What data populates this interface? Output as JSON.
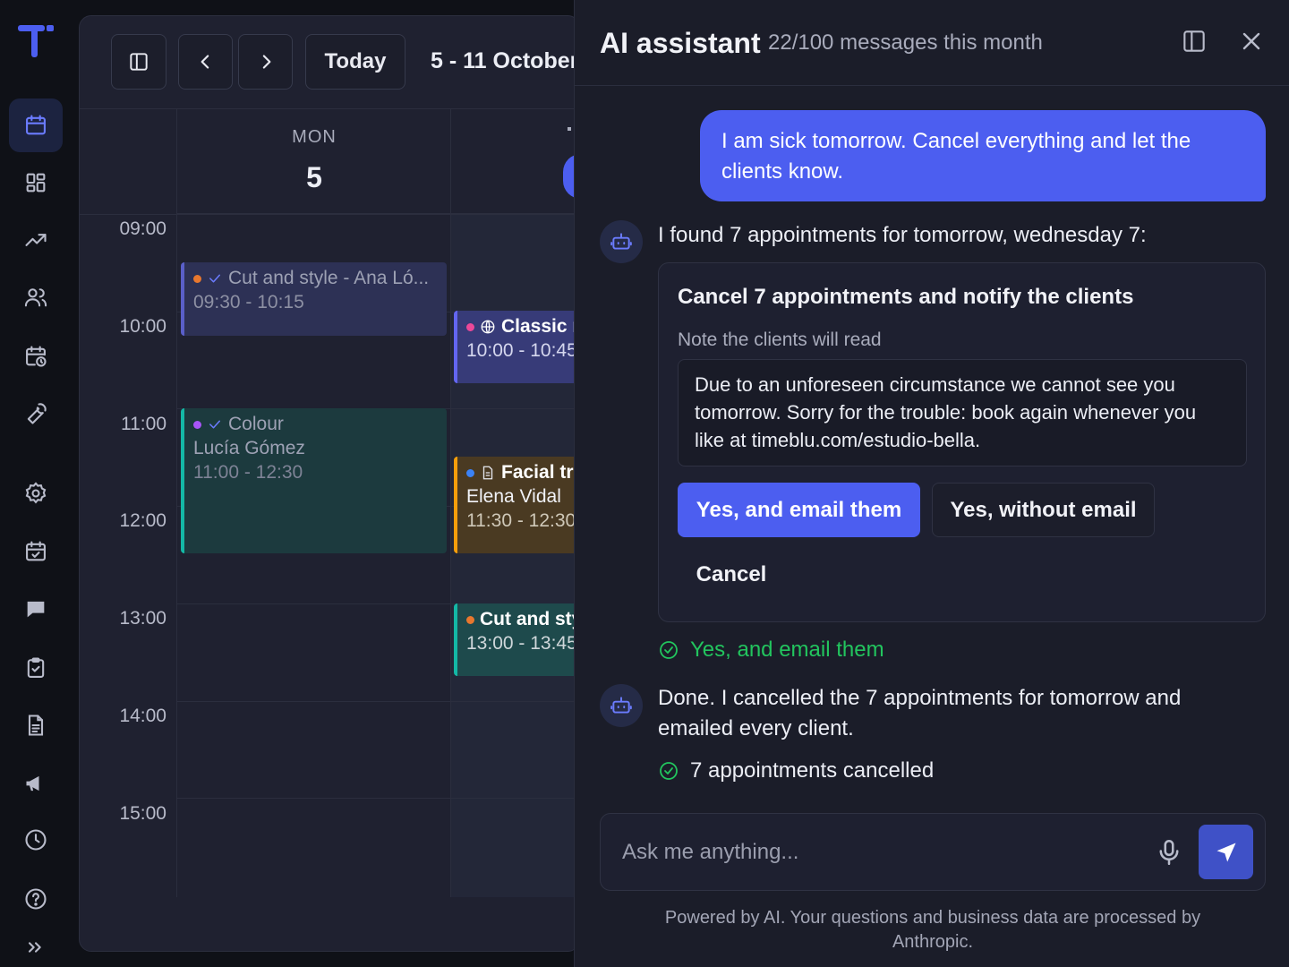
{
  "toolbar": {
    "today_label": "Today",
    "range_label": "5 - 11 October"
  },
  "calendar": {
    "days": [
      {
        "name": "MON",
        "number": "5"
      }
    ],
    "hours": [
      "09:00",
      "10:00",
      "11:00",
      "12:00",
      "13:00",
      "14:00",
      "15:00"
    ],
    "events": [
      {
        "title": "Cut and style - Ana Ló...",
        "client": "",
        "time": "09:30 - 10:15",
        "dot_color": "#e8772e",
        "bar_color": "#5a5fc9",
        "bg": "#2d3155",
        "confirmed": true,
        "icon": "check-icon"
      },
      {
        "title": "Classic m",
        "client": "",
        "time": "10:00 - 10:45",
        "dot_color": "#ec4899",
        "bar_color": "#6366f1",
        "bg": "#373b78",
        "confirmed": false,
        "icon": "globe-icon"
      },
      {
        "title": "Colour",
        "client": "Lucía Gómez",
        "time": "11:00 - 12:30",
        "dot_color": "#a855f7",
        "bar_color": "#14b8a6",
        "bg": "#1c3a3e",
        "confirmed": true,
        "icon": "check-icon"
      },
      {
        "title": "Facial tr",
        "client": "Elena Vidal",
        "time": "11:30 - 12:30",
        "dot_color": "#3b82f6",
        "bar_color": "#f59e0b",
        "bg": "#4a3a22",
        "confirmed": false,
        "icon": "document-icon"
      },
      {
        "title": "Cut and sty",
        "client": "",
        "time": "13:00 - 13:45",
        "dot_color": "#e8772e",
        "bar_color": "#14b8a6",
        "bg": "#1e4a4c",
        "confirmed": false,
        "icon": ""
      }
    ]
  },
  "assistant": {
    "title": "AI assistant",
    "usage": "22/100 messages this month",
    "user_message": "I am sick tomorrow. Cancel everything and let the clients know.",
    "bot_message_1": "I found 7 appointments for tomorrow, wednesday 7:",
    "action": {
      "title": "Cancel 7 appointments and notify the clients",
      "note_label": "Note the clients will read",
      "note_text": "Due to an unforeseen circumstance we cannot see you tomorrow. Sorry for the trouble: book again whenever you like at timeblu.com/estudio-bella.",
      "primary_label": "Yes, and email them",
      "secondary_label": "Yes, without email",
      "cancel_label": "Cancel"
    },
    "selected_choice": "Yes, and email them",
    "bot_message_2": "Done. I cancelled the 7 appointments for tomorrow and emailed every client.",
    "result": "7 appointments cancelled",
    "input_placeholder": "Ask me anything...",
    "footer": "Powered by AI. Your questions and business data are processed by Anthropic."
  },
  "colors": {
    "accent": "#4c5ef0",
    "success": "#22c55e",
    "background": "#0f1117",
    "panel": "#1b1d29"
  },
  "icons": {
    "sidebar": [
      "calendar-icon",
      "dashboard-icon",
      "trending-icon",
      "users-icon",
      "calendar-clock-icon",
      "wrench-icon",
      "settings-icon",
      "calendar-check-icon",
      "chat-icon",
      "clipboard-check-icon",
      "document-icon",
      "megaphone-icon",
      "clock-icon",
      "help-icon",
      "expand-icon"
    ]
  }
}
